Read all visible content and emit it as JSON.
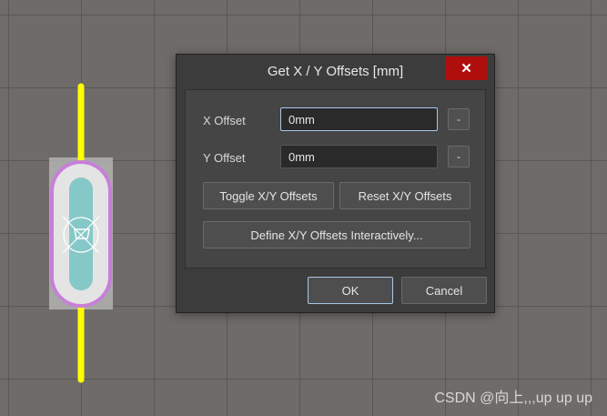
{
  "dialog": {
    "title": "Get X / Y Offsets [mm]",
    "close_label": "✕",
    "x_offset": {
      "label": "X Offset",
      "value": "0mm",
      "button": "-"
    },
    "y_offset": {
      "label": "Y Offset",
      "value": "0mm",
      "button": "-"
    },
    "toggle_label": "Toggle X/Y Offsets",
    "reset_label": "Reset X/Y Offsets",
    "define_label": "Define X/Y Offsets Interactively...",
    "ok_label": "OK",
    "cancel_label": "Cancel"
  },
  "watermark": "CSDN @向上,,,up up up",
  "colors": {
    "canvas_bg": "#6e6b69",
    "lead": "#ffff00",
    "pad_outline": "#c87fd8",
    "pad_body": "#e4e4e4",
    "pad_core": "#86c8c8",
    "close_red": "#b00d0d",
    "focus_border": "#a9c7e8"
  }
}
